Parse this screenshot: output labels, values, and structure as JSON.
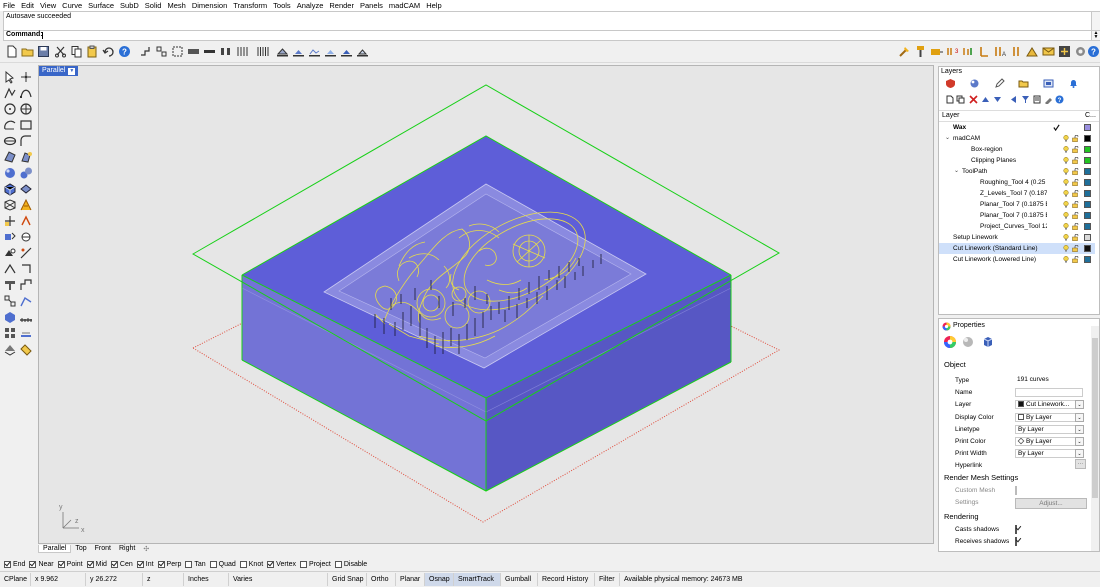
{
  "menu": [
    "File",
    "Edit",
    "View",
    "Curve",
    "Surface",
    "SubD",
    "Solid",
    "Mesh",
    "Dimension",
    "Transform",
    "Tools",
    "Analyze",
    "Render",
    "Panels",
    "madCAM",
    "Help"
  ],
  "command_history": "Autosave succeeded",
  "command_prompt": "Command:",
  "viewport": {
    "active_label": "Parallel",
    "tabs": [
      "Parallel",
      "Top",
      "Front",
      "Right"
    ],
    "axis_y": "y",
    "axis_x": "x",
    "axis_z": "z"
  },
  "osnaps": [
    {
      "label": "End",
      "on": true
    },
    {
      "label": "Near",
      "on": true
    },
    {
      "label": "Point",
      "on": true
    },
    {
      "label": "Mid",
      "on": true
    },
    {
      "label": "Cen",
      "on": true
    },
    {
      "label": "Int",
      "on": true
    },
    {
      "label": "Perp",
      "on": true
    },
    {
      "label": "Tan",
      "on": false
    },
    {
      "label": "Quad",
      "on": false
    },
    {
      "label": "Knot",
      "on": false
    },
    {
      "label": "Vertex",
      "on": true
    },
    {
      "label": "Project",
      "on": false
    },
    {
      "label": "Disable",
      "on": false
    }
  ],
  "status": {
    "cplane": "CPlane",
    "x": "x 9.962",
    "y": "y 26.272",
    "z": "z",
    "units": "Inches",
    "varies": "Varies",
    "grid_snap": "Grid Snap",
    "ortho": "Ortho",
    "planar": "Planar",
    "osnap": "Osnap",
    "smarttrack": "SmartTrack",
    "gumball": "Gumball",
    "record_history": "Record History",
    "filter": "Filter",
    "memory": "Available physical memory: 24673 MB"
  },
  "layers": {
    "title": "Layers",
    "col_layer": "Layer",
    "col_color": "C...",
    "rows": [
      {
        "name": "Wax",
        "indent": 0,
        "expander": "",
        "current": true,
        "color": "#9a8fe0",
        "selected": false
      },
      {
        "name": "madCAM",
        "indent": 0,
        "expander": "⌄",
        "current": false,
        "color": "#000000",
        "selected": false
      },
      {
        "name": "Box-region",
        "indent": 2,
        "expander": "",
        "current": false,
        "color": "#22c422",
        "selected": false
      },
      {
        "name": "Clipping Planes",
        "indent": 2,
        "expander": "",
        "current": false,
        "color": "#22c422",
        "selected": false
      },
      {
        "name": "ToolPath",
        "indent": 1,
        "expander": "⌄",
        "current": false,
        "color": "#1f6f9a",
        "selected": false
      },
      {
        "name": "Roughing_Tool 4 (0.25 B...",
        "indent": 3,
        "expander": "",
        "current": false,
        "color": "#1f6f9a",
        "selected": false
      },
      {
        "name": "Z_Levels_Tool 7 (0.1875 ...",
        "indent": 3,
        "expander": "",
        "current": false,
        "color": "#1f6f9a",
        "selected": false
      },
      {
        "name": "Planar_Tool 7 (0.1875 Ba...",
        "indent": 3,
        "expander": "",
        "current": false,
        "color": "#1f6f9a",
        "selected": false
      },
      {
        "name": "Planar_Tool 7 (0.1875 Ba...",
        "indent": 3,
        "expander": "",
        "current": false,
        "color": "#1f6f9a",
        "selected": false
      },
      {
        "name": "Project_Curves_Tool 12 (...",
        "indent": 3,
        "expander": "",
        "current": false,
        "color": "#1f6f9a",
        "selected": false
      },
      {
        "name": "Setup Linework",
        "indent": 0,
        "expander": "",
        "current": false,
        "color": "#d9d9d9",
        "selected": false
      },
      {
        "name": "Cut Linework (Standard Line)",
        "indent": 0,
        "expander": "",
        "current": false,
        "color": "#111111",
        "selected": true
      },
      {
        "name": "Cut Linework (Lowered Line)",
        "indent": 0,
        "expander": "",
        "current": false,
        "color": "#1f6f9a",
        "selected": false
      }
    ]
  },
  "properties": {
    "title": "Properties",
    "section_object": "Object",
    "fields": [
      {
        "key": "Type",
        "value": "191 curves",
        "style": "plain",
        "dd": false,
        "swatch": ""
      },
      {
        "key": "Name",
        "value": "",
        "style": "box",
        "dd": false,
        "swatch": ""
      },
      {
        "key": "Layer",
        "value": "Cut Linework...",
        "style": "box",
        "dd": true,
        "swatch": "#111111"
      },
      {
        "key": "Display Color",
        "value": "By Layer",
        "style": "box",
        "dd": true,
        "swatch": "#ffffff"
      },
      {
        "key": "Linetype",
        "value": "By Layer",
        "style": "box",
        "dd": true,
        "swatch": ""
      },
      {
        "key": "Print Color",
        "value": "By Layer",
        "style": "box",
        "dd": true,
        "swatch": "diamond"
      },
      {
        "key": "Print Width",
        "value": "By Layer",
        "style": "box",
        "dd": true,
        "swatch": ""
      },
      {
        "key": "Hyperlink",
        "value": "",
        "style": "plain",
        "dd": false,
        "swatch": ""
      }
    ],
    "hyperlink_button": "...",
    "section_render_mesh": "Render Mesh Settings",
    "custom_mesh": "Custom Mesh",
    "settings": "Settings",
    "adjust_button": "Adjust...",
    "section_rendering": "Rendering",
    "casts_shadows": "Casts shadows",
    "receives_shadows": "Receives shadows"
  },
  "colors": {
    "wax_top": "#5e5ed8",
    "wax_side_left": "#7373d6",
    "wax_side_right": "#5757c4",
    "selection_green": "#18d018",
    "clip_red": "#e04c3c",
    "curve_yellow": "#e8dd4a",
    "viewport_bg": "#e6e6e6"
  }
}
